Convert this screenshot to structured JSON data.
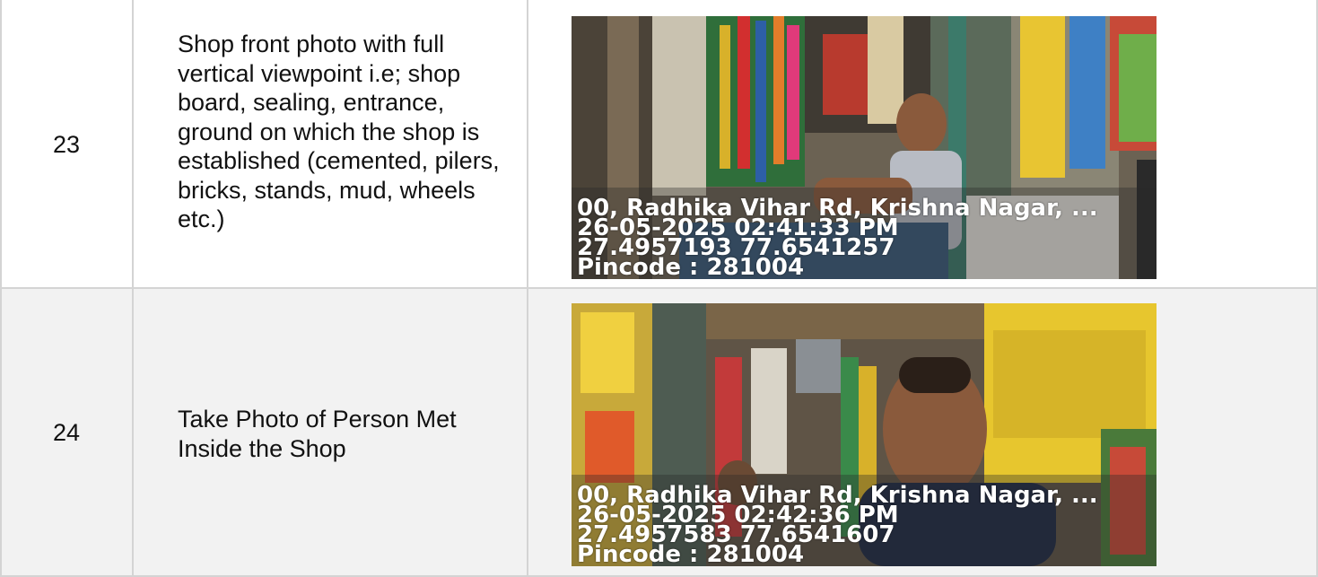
{
  "rows": [
    {
      "number": "23",
      "description": "Shop front photo with full vertical viewpoint i.e; shop board, sealing, entrance, ground on which the shop is established (cemented, pilers, bricks, stands, mud, wheels etc.)",
      "photo": {
        "address": "00, Radhika Vihar Rd, Krishna Nagar, ...",
        "datetime": "26-05-2025 02:41:33 PM",
        "coordinates": "27.4957193 77.6541257",
        "pincode": "Pincode : 281004"
      }
    },
    {
      "number": "24",
      "description": "Take Photo of Person Met Inside the Shop",
      "photo": {
        "address": "00, Radhika Vihar Rd, Krishna Nagar, ...",
        "datetime": "26-05-2025 02:42:36 PM",
        "coordinates": "27.4957583 77.6541607",
        "pincode": "Pincode : 281004"
      }
    }
  ],
  "colors": {
    "border": "#d4d4d4",
    "row_alt": "#f2f2f2",
    "text": "#111111",
    "stamp_text": "#ffffff"
  }
}
